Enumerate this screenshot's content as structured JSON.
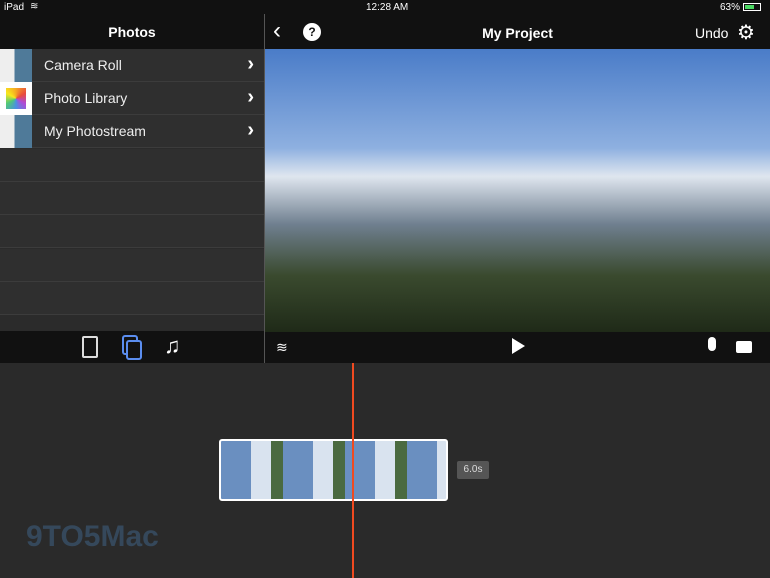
{
  "status": {
    "device": "iPad",
    "time": "12:28 AM",
    "battery": "63%"
  },
  "sidebar": {
    "title": "Photos",
    "items": [
      {
        "label": "Camera Roll"
      },
      {
        "label": "Photo Library"
      },
      {
        "label": "My Photostream"
      }
    ]
  },
  "header": {
    "title": "My Project",
    "undo": "Undo",
    "help": "?"
  },
  "timeline": {
    "duration": "6.0s"
  },
  "watermark": "9TO5Mac",
  "colors": {
    "accent": "#5b8def",
    "playhead": "#f04a20",
    "battery": "#4cd964"
  }
}
